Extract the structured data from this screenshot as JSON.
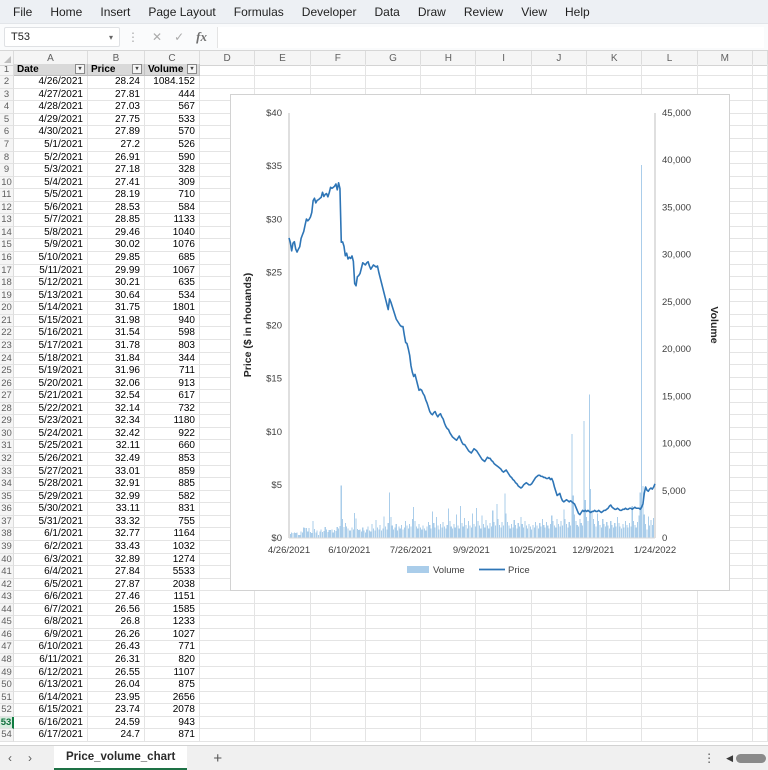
{
  "menu": {
    "items": [
      "File",
      "Home",
      "Insert",
      "Page Layout",
      "Formulas",
      "Developer",
      "Data",
      "Draw",
      "Review",
      "View",
      "Help"
    ]
  },
  "formula_bar": {
    "name_box": "T53",
    "formula": "",
    "icons": [
      "cancel-x",
      "confirm-check",
      "fx"
    ]
  },
  "grid": {
    "column_letters": [
      "A",
      "B",
      "C",
      "D",
      "E",
      "F",
      "G",
      "H",
      "I",
      "J",
      "K",
      "L",
      "M"
    ],
    "header_row": {
      "row_number": "1",
      "date": "Date",
      "price": "Price",
      "volume": "Volume"
    },
    "active_row_header": 53,
    "rows": [
      [
        "4/26/2021",
        "28.24",
        "1084.152"
      ],
      [
        "4/27/2021",
        "27.81",
        "444"
      ],
      [
        "4/28/2021",
        "27.03",
        "567"
      ],
      [
        "4/29/2021",
        "27.75",
        "533"
      ],
      [
        "4/30/2021",
        "27.89",
        "570"
      ],
      [
        "5/1/2021",
        "27.2",
        "526"
      ],
      [
        "5/2/2021",
        "26.91",
        "590"
      ],
      [
        "5/3/2021",
        "27.18",
        "328"
      ],
      [
        "5/4/2021",
        "27.41",
        "309"
      ],
      [
        "5/5/2021",
        "28.19",
        "710"
      ],
      [
        "5/6/2021",
        "28.53",
        "584"
      ],
      [
        "5/7/2021",
        "28.85",
        "1133"
      ],
      [
        "5/8/2021",
        "29.46",
        "1040"
      ],
      [
        "5/9/2021",
        "30.02",
        "1076"
      ],
      [
        "5/10/2021",
        "29.85",
        "685"
      ],
      [
        "5/11/2021",
        "29.99",
        "1067"
      ],
      [
        "5/12/2021",
        "30.21",
        "635"
      ],
      [
        "5/13/2021",
        "30.64",
        "534"
      ],
      [
        "5/14/2021",
        "31.75",
        "1801"
      ],
      [
        "5/15/2021",
        "31.98",
        "940"
      ],
      [
        "5/16/2021",
        "31.54",
        "598"
      ],
      [
        "5/17/2021",
        "31.78",
        "803"
      ],
      [
        "5/18/2021",
        "31.84",
        "344"
      ],
      [
        "5/19/2021",
        "31.96",
        "711"
      ],
      [
        "5/20/2021",
        "32.06",
        "913"
      ],
      [
        "5/21/2021",
        "32.54",
        "617"
      ],
      [
        "5/22/2021",
        "32.14",
        "732"
      ],
      [
        "5/23/2021",
        "32.34",
        "1180"
      ],
      [
        "5/24/2021",
        "32.42",
        "922"
      ],
      [
        "5/25/2021",
        "32.11",
        "660"
      ],
      [
        "5/26/2021",
        "32.49",
        "853"
      ],
      [
        "5/27/2021",
        "33.01",
        "859"
      ],
      [
        "5/28/2021",
        "32.91",
        "885"
      ],
      [
        "5/29/2021",
        "32.99",
        "582"
      ],
      [
        "5/30/2021",
        "33.11",
        "831"
      ],
      [
        "5/31/2021",
        "33.32",
        "755"
      ],
      [
        "6/1/2021",
        "32.77",
        "1164"
      ],
      [
        "6/2/2021",
        "33.43",
        "1032"
      ],
      [
        "6/3/2021",
        "32.89",
        "1274"
      ],
      [
        "6/4/2021",
        "27.84",
        "5533"
      ],
      [
        "6/5/2021",
        "27.87",
        "2038"
      ],
      [
        "6/6/2021",
        "27.46",
        "1151"
      ],
      [
        "6/7/2021",
        "26.56",
        "1585"
      ],
      [
        "6/8/2021",
        "26.8",
        "1233"
      ],
      [
        "6/9/2021",
        "26.26",
        "1027"
      ],
      [
        "6/10/2021",
        "26.43",
        "771"
      ],
      [
        "6/11/2021",
        "26.31",
        "820"
      ],
      [
        "6/12/2021",
        "26.55",
        "1107"
      ],
      [
        "6/13/2021",
        "26.04",
        "875"
      ],
      [
        "6/14/2021",
        "23.95",
        "2656"
      ],
      [
        "6/15/2021",
        "23.74",
        "2078"
      ],
      [
        "6/16/2021",
        "24.59",
        "943"
      ],
      [
        "6/17/2021",
        "24.7",
        "871"
      ]
    ]
  },
  "sheet_tabs": {
    "active": "Price_volume_chart",
    "add_label": "+"
  },
  "chart_data": {
    "type": "combo",
    "x_start_date": "4/26/2021",
    "x_end_date": "1/24/2022",
    "x_ticks": [
      {
        "d": 0,
        "label": "4/26/2021"
      },
      {
        "d": 45,
        "label": "6/10/2021"
      },
      {
        "d": 91,
        "label": "7/26/2021"
      },
      {
        "d": 136,
        "label": "9/9/2021"
      },
      {
        "d": 182,
        "label": "10/25/2021"
      },
      {
        "d": 227,
        "label": "12/9/2021"
      },
      {
        "d": 273,
        "label": "1/24/2022"
      }
    ],
    "left_axis": {
      "title": "Price ($ in rhouands)",
      "min": 0,
      "max": 40,
      "step": 5,
      "tick_labels": [
        "$0",
        "$5",
        "$10",
        "$15",
        "$20",
        "$25",
        "$30",
        "$35",
        "$40"
      ]
    },
    "right_axis": {
      "title": "Volume",
      "min": 0,
      "max": 45000,
      "step": 5000,
      "tick_labels": [
        "0",
        "5,000",
        "10,000",
        "15,000",
        "20,000",
        "25,000",
        "30,000",
        "35,000",
        "40,000",
        "45,000"
      ]
    },
    "legend": {
      "position": "bottom",
      "entries": [
        "Volume",
        "Price"
      ]
    },
    "grid": "off",
    "series": [
      {
        "name": "Volume",
        "type": "bar",
        "axis": "right",
        "color": "#aacdea",
        "values": [
          1084,
          444,
          567,
          533,
          570,
          526,
          590,
          328,
          309,
          710,
          584,
          1133,
          1040,
          1076,
          685,
          1067,
          635,
          534,
          1801,
          940,
          598,
          803,
          344,
          711,
          913,
          617,
          732,
          1180,
          922,
          660,
          853,
          859,
          885,
          582,
          831,
          755,
          1164,
          1032,
          1274,
          5533,
          2038,
          1151,
          1585,
          1233,
          1027,
          771,
          820,
          1107,
          875,
          2656,
          2078,
          943,
          871,
          900,
          700,
          1100,
          800,
          600,
          900,
          1200,
          800,
          700,
          1500,
          1000,
          800,
          1900,
          1100,
          900,
          1400,
          800,
          1000,
          2300,
          1200,
          900,
          1600,
          4800,
          2200,
          1300,
          900,
          1100,
          1500,
          800,
          1200,
          1000,
          1400,
          900,
          1100,
          1800,
          1300,
          1000,
          1500,
          1200,
          2000,
          3300,
          1800,
          1200,
          1000,
          1500,
          1100,
          900,
          1300,
          1000,
          800,
          1200,
          1700,
          1400,
          1000,
          2800,
          1600,
          1100,
          2200,
          1300,
          900,
          1500,
          1100,
          1700,
          1200,
          1000,
          1400,
          3100,
          1800,
          1200,
          1000,
          1500,
          1100,
          2500,
          1300,
          1000,
          3400,
          1600,
          1200,
          2100,
          1400,
          1000,
          1800,
          1300,
          1100,
          2600,
          1500,
          1200,
          3200,
          1800,
          1300,
          1000,
          2400,
          1500,
          1100,
          1900,
          1300,
          1000,
          1600,
          1200,
          2900,
          1700,
          1300,
          3600,
          2000,
          1400,
          1100,
          1700,
          1300,
          4700,
          2600,
          1700,
          1300,
          1000,
          1500,
          1100,
          1900,
          1400,
          1000,
          1600,
          1200,
          2200,
          1500,
          1100,
          1800,
          1300,
          1000,
          1500,
          1200,
          900,
          1400,
          1100,
          1700,
          1300,
          1000,
          1600,
          1200,
          2000,
          1400,
          1100,
          1700,
          1300,
          1000,
          1500,
          2400,
          1800,
          1300,
          1100,
          2000,
          1500,
          1200,
          1800,
          1300,
          3000,
          2000,
          1500,
          1100,
          1700,
          1300,
          11000,
          4500,
          2500,
          1800,
          1400,
          1200,
          2000,
          1600,
          1300,
          12400,
          4000,
          2200,
          1800,
          15200,
          5200,
          2800,
          2000,
          1500,
          1200,
          2600,
          1800,
          1400,
          1100,
          2000,
          1500,
          1200,
          1700,
          1300,
          1000,
          1800,
          1400,
          1100,
          1600,
          1200,
          2200,
          1600,
          1200,
          1000,
          1500,
          1100,
          1800,
          1400,
          1100,
          1600,
          1200,
          3400,
          1800,
          1400,
          1100,
          1700,
          2400,
          4800,
          39500,
          5500,
          2500,
          1500,
          900,
          2300,
          1300,
          1900,
          1400,
          2100,
          1800
        ]
      },
      {
        "name": "Price",
        "type": "line",
        "axis": "left",
        "color": "#2e75b6",
        "values": [
          28.24,
          27.81,
          27.03,
          27.75,
          27.89,
          27.2,
          26.91,
          27.18,
          27.41,
          28.19,
          28.53,
          28.85,
          29.46,
          30.02,
          29.85,
          29.99,
          30.21,
          30.64,
          31.75,
          31.98,
          31.54,
          31.78,
          31.84,
          31.96,
          32.06,
          32.54,
          32.14,
          32.34,
          32.42,
          32.11,
          32.49,
          33.01,
          32.91,
          32.99,
          33.11,
          33.32,
          32.77,
          33.43,
          32.89,
          27.84,
          27.87,
          27.46,
          26.56,
          26.8,
          26.26,
          26.43,
          26.31,
          26.55,
          26.04,
          23.95,
          23.74,
          24.59,
          24.7,
          24.9,
          25.4,
          25.9,
          25.8,
          25.7,
          25.9,
          26.0,
          25.6,
          25.3,
          25.5,
          25.7,
          25.6,
          25.5,
          25.6,
          25.0,
          24.5,
          24.0,
          23.5,
          23.0,
          22.5,
          22.0,
          21.5,
          22.5,
          22.2,
          21.8,
          21.4,
          21.0,
          20.6,
          20.4,
          20.2,
          20.0,
          19.9,
          19.9,
          19.1,
          18.4,
          18.3,
          17.8,
          17.2,
          16.2,
          15.6,
          15.2,
          15.4,
          14.9,
          14.4,
          13.9,
          14.0,
          13.9,
          13.6,
          13.4,
          13.0,
          12.7,
          12.3,
          11.9,
          11.7,
          11.6,
          11.8,
          11.9,
          11.6,
          11.4,
          11.6,
          11.7,
          11.4,
          11.2,
          10.8,
          10.5,
          10.3,
          10.2,
          9.9,
          9.7,
          9.5,
          9.4,
          9.3,
          9.2,
          9.4,
          9.6,
          9.3,
          9.0,
          8.8,
          8.8,
          8.6,
          8.4,
          8.2,
          8.1,
          8.0,
          8.2,
          8.4,
          8.3,
          8.2,
          8.0,
          7.8,
          7.6,
          7.4,
          7.3,
          7.2,
          7.4,
          7.6,
          7.5,
          7.5,
          7.3,
          7.2,
          7.0,
          6.9,
          6.8,
          6.7,
          6.6,
          6.5,
          6.3,
          6.2,
          6.3,
          6.4,
          6.2,
          6.0,
          5.8,
          5.7,
          5.5,
          5.4,
          5.2,
          5.1,
          4.9,
          4.8,
          4.7,
          4.8,
          5.0,
          5.1,
          5.2,
          5.1,
          5.0,
          5.0,
          5.1,
          5.3,
          5.5,
          5.7,
          5.8,
          5.9,
          5.9,
          5.8,
          5.8,
          5.7,
          5.7,
          5.6,
          5.6,
          5.7,
          5.5,
          5.6,
          5.3,
          4.8,
          4.4,
          4.0,
          4.1,
          4.2,
          3.8,
          3.5,
          3.4,
          3.5,
          3.6,
          3.5,
          3.4,
          3.5,
          3.4,
          3.3,
          3.2,
          2.9,
          2.6,
          2.3,
          2.2,
          2.4,
          2.6,
          2.5,
          2.6,
          2.5,
          2.6,
          2.5,
          2.4,
          2.5,
          2.5,
          2.6,
          2.5,
          2.5,
          2.6,
          2.5,
          2.4,
          2.5,
          2.6,
          2.6,
          2.7,
          2.8,
          3.0,
          3.1,
          2.9,
          2.8,
          2.7,
          2.7,
          2.8,
          2.7,
          2.6,
          2.6,
          2.7,
          2.7,
          2.8,
          2.7,
          2.7,
          2.8,
          2.8,
          2.7,
          2.8,
          2.9,
          2.8,
          2.8,
          2.8,
          2.7,
          2.9,
          3.2,
          4.2,
          4.8,
          4.5,
          4.4,
          4.6,
          4.7,
          4.6,
          4.8,
          5.1
        ]
      }
    ]
  },
  "colors": {
    "excel_green": "#1e7145",
    "bar_fill": "#aacdea",
    "line_stroke": "#2e75b6"
  }
}
